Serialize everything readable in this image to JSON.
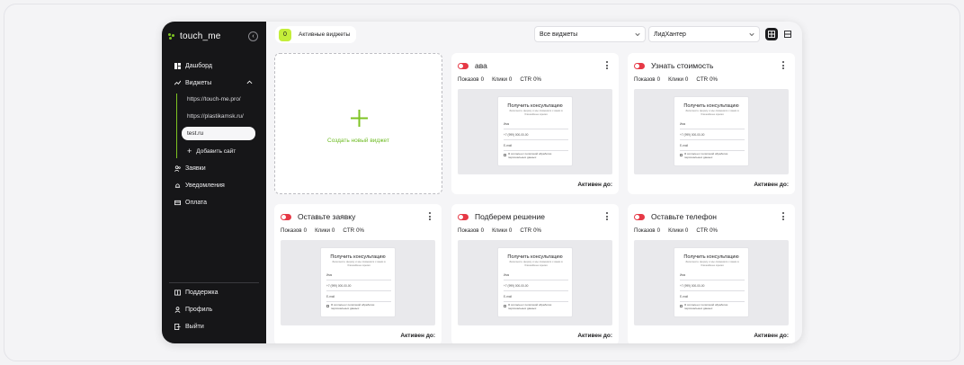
{
  "brand": {
    "name": "touch_me"
  },
  "sidebar": {
    "items": [
      {
        "label": "Дашборд",
        "icon": "dashboard-icon"
      },
      {
        "label": "Виджеты",
        "icon": "widgets-icon"
      },
      {
        "label": "Заявки",
        "icon": "requests-icon"
      },
      {
        "label": "Уведомления",
        "icon": "bell-icon"
      },
      {
        "label": "Оплата",
        "icon": "card-icon"
      }
    ],
    "sites": [
      "https://touch-me.pro/",
      "https://plastikamsk.ru/",
      "test.ru"
    ],
    "add_site": "Добавить сайт",
    "bottom": [
      {
        "label": "Поддержка",
        "icon": "book-icon"
      },
      {
        "label": "Профиль",
        "icon": "user-icon"
      },
      {
        "label": "Выйти",
        "icon": "logout-icon"
      }
    ]
  },
  "toolbar": {
    "active_count": "0",
    "active_label": "Активные виджеты",
    "filter_select": "Все виджеты",
    "project_select": "ЛидХантер"
  },
  "create_card": {
    "label": "Создать новый виджет"
  },
  "stats_labels": {
    "shows": "Показов",
    "clicks": "Клики",
    "ctr": "CTR"
  },
  "active_until_label": "Активен до:",
  "preview": {
    "title": "Получить консультацию",
    "subtitle": "Заполните форму и мы свяжемся с вами в ближайшее время",
    "name_label": "Имя",
    "phone_value": "+7 (999) 000-00-00",
    "email_label": "E-mail",
    "consent": "Я согласен с политикой обработки персональных данных"
  },
  "widgets": [
    {
      "title": "ава",
      "shows": "0",
      "clicks": "0",
      "ctr": "0%"
    },
    {
      "title": "Узнать стоимость",
      "shows": "0",
      "clicks": "0",
      "ctr": "0%"
    },
    {
      "title": "Оставьте заявку",
      "shows": "0",
      "clicks": "0",
      "ctr": "0%"
    },
    {
      "title": "Подберем решение",
      "shows": "0",
      "clicks": "0",
      "ctr": "0%"
    },
    {
      "title": "Оставьте телефон",
      "shows": "0",
      "clicks": "0",
      "ctr": "0%"
    }
  ],
  "colors": {
    "accent": "#7ec322",
    "toggle_off": "#e63946",
    "sidebar_bg": "#161618",
    "badge": "#c4ee3a"
  }
}
